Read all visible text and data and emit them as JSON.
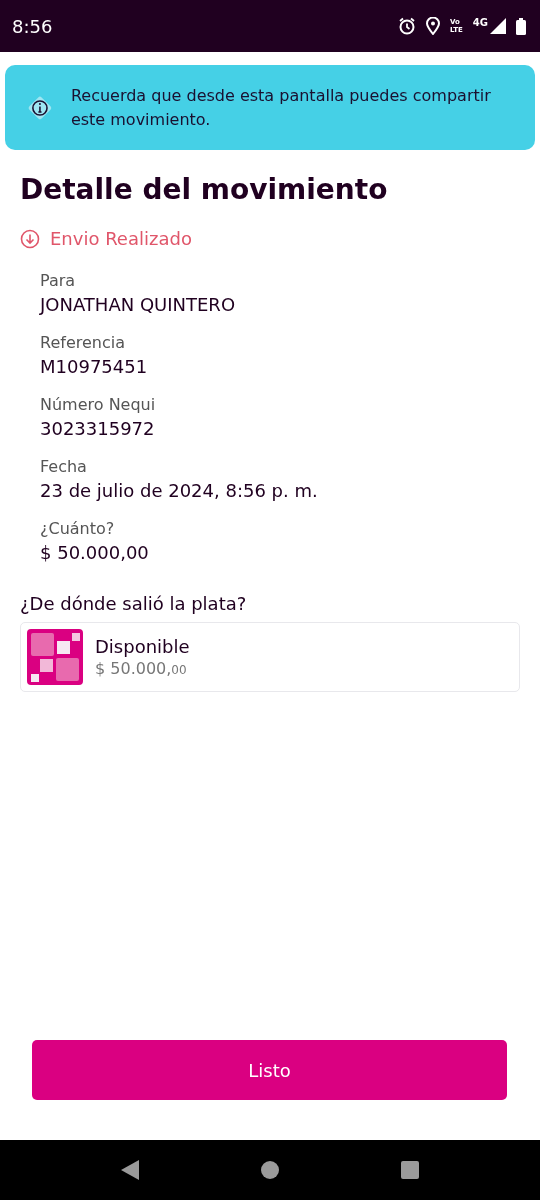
{
  "status_bar": {
    "time": "8:56",
    "volte": [
      "Vo",
      "LTE"
    ],
    "network": "4G"
  },
  "toast": {
    "message": "Recuerda que desde esta pantalla puedes compartir este movimiento."
  },
  "title": "Detalle del movimiento",
  "status": {
    "label": "Envio Realizado",
    "color": "#e0566a"
  },
  "fields": [
    {
      "label": "Para",
      "value": "JONATHAN QUINTERO"
    },
    {
      "label": "Referencia",
      "value": "M10975451"
    },
    {
      "label": "Número Nequi",
      "value": "3023315972"
    },
    {
      "label": "Fecha",
      "value": "23 de julio de 2024, 8:56 p. m."
    },
    {
      "label": "¿Cuánto?",
      "value": "$ 50.000,00"
    }
  ],
  "source": {
    "heading": "¿De dónde salió la plata?",
    "name": "Disponible",
    "amount_whole": "$ 50.000,",
    "amount_cents": "00"
  },
  "button": "Listo"
}
